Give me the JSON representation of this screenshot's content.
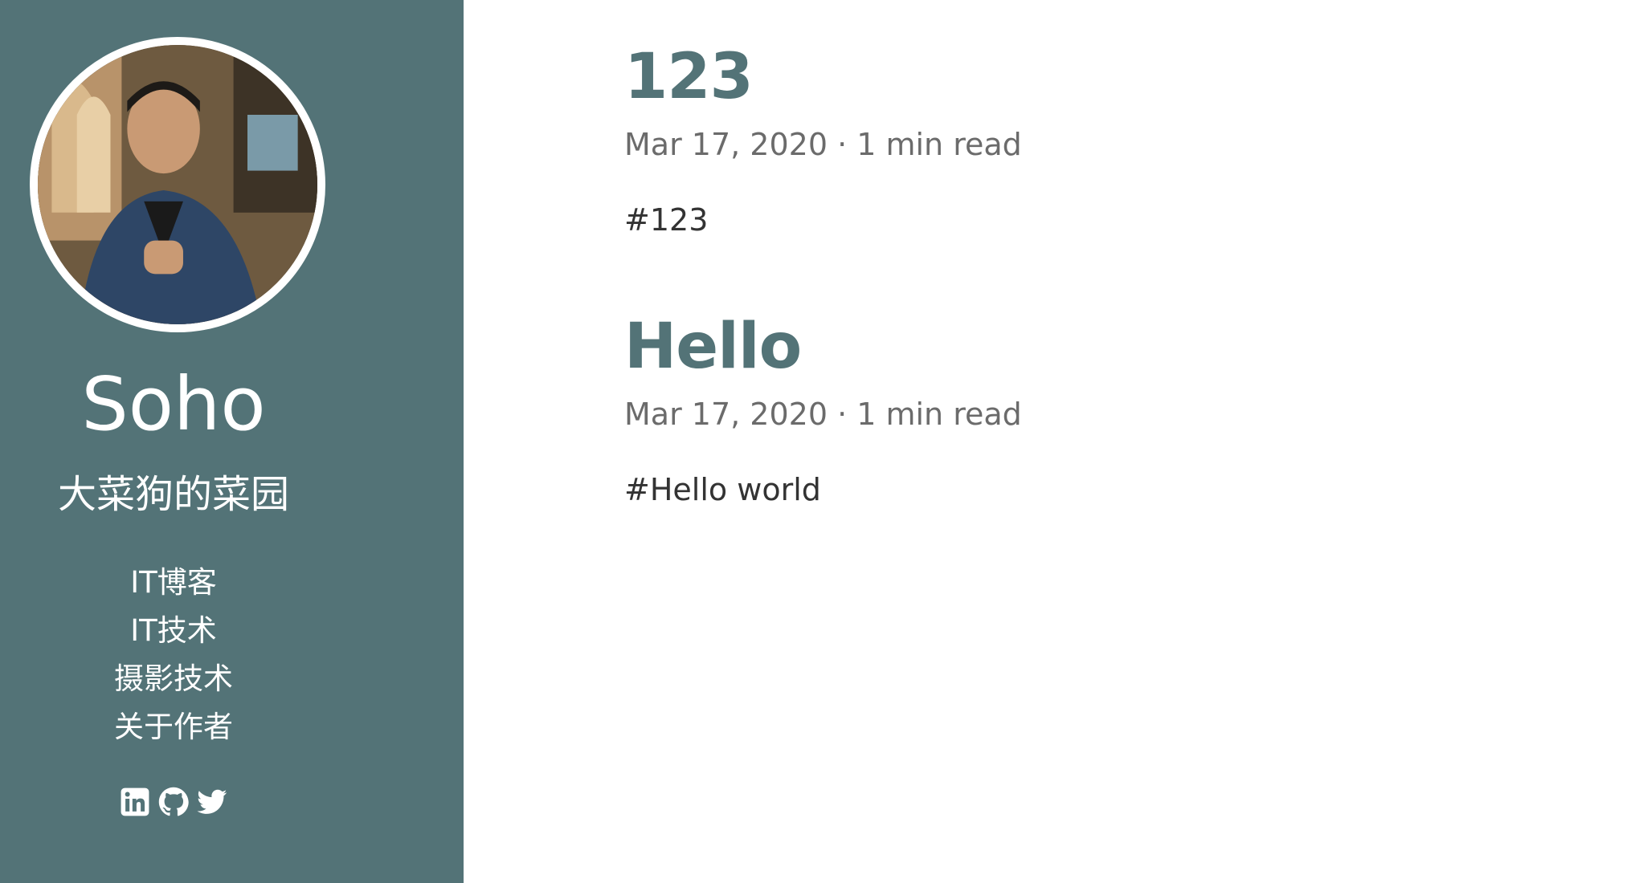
{
  "sidebar": {
    "title": "Soho",
    "subtitle": "大菜狗的菜园",
    "nav": [
      {
        "label": "IT博客"
      },
      {
        "label": "IT技术"
      },
      {
        "label": "摄影技术"
      },
      {
        "label": "关于作者"
      }
    ],
    "social": [
      {
        "icon": "linkedin-icon"
      },
      {
        "icon": "github-icon"
      },
      {
        "icon": "twitter-icon"
      }
    ]
  },
  "posts": [
    {
      "title": "123",
      "meta": "Mar 17, 2020 · 1 min read",
      "excerpt": "#123"
    },
    {
      "title": "Hello",
      "meta": "Mar 17, 2020 · 1 min read",
      "excerpt": "#Hello world"
    }
  ],
  "colors": {
    "sidebar_bg": "#537377",
    "accent": "#537377",
    "meta_text": "#6b6b6b",
    "body_text": "#333333"
  }
}
